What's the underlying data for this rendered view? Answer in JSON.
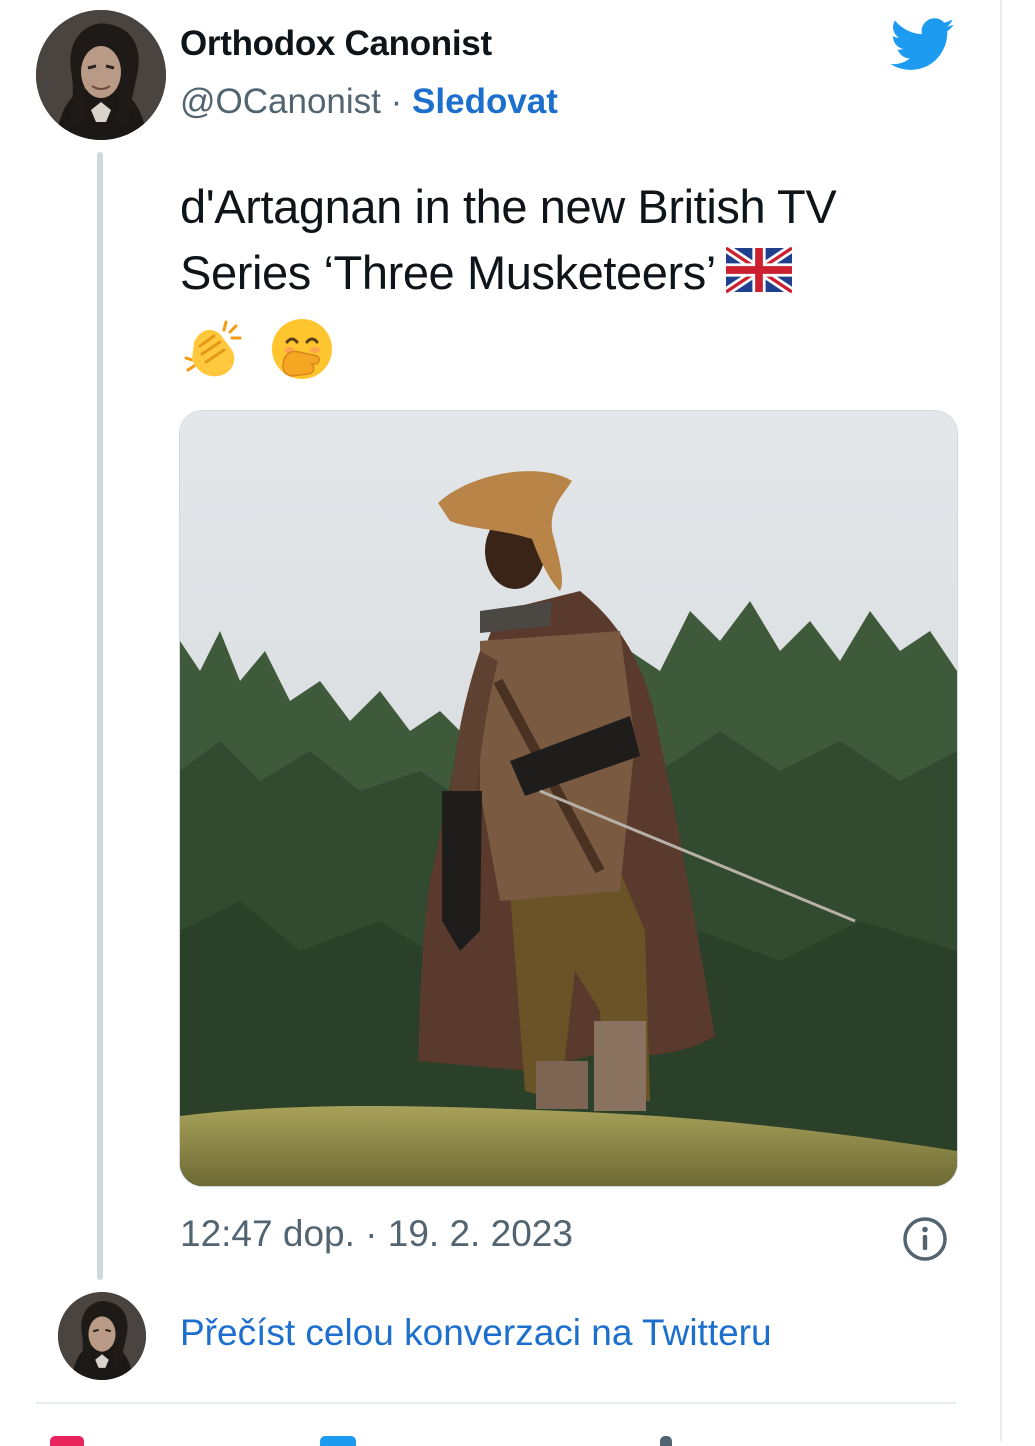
{
  "tweet": {
    "author": {
      "display_name": "Orthodox Canonist",
      "handle": "@OCanonist",
      "separator": "·",
      "follow_label": "Sledovat"
    },
    "text_line1": "d'Artagnan in the new British TV",
    "text_line2": "Series ‘Three Musketeers’",
    "emojis": [
      "flag-united-kingdom",
      "clapping-hands",
      "face-with-hand-over-mouth"
    ],
    "timestamp": "12:47 dop. · 19. 2. 2023",
    "read_conversation": "Přečíst celou konverzaci na Twitteru"
  },
  "icons": {
    "brand": "twitter-bird-icon",
    "info": "info-icon"
  },
  "colors": {
    "twitter_blue": "#1d9bf0",
    "link_blue": "#1d6fce",
    "secondary_text": "#536471",
    "thread_line": "#cfd9de"
  }
}
